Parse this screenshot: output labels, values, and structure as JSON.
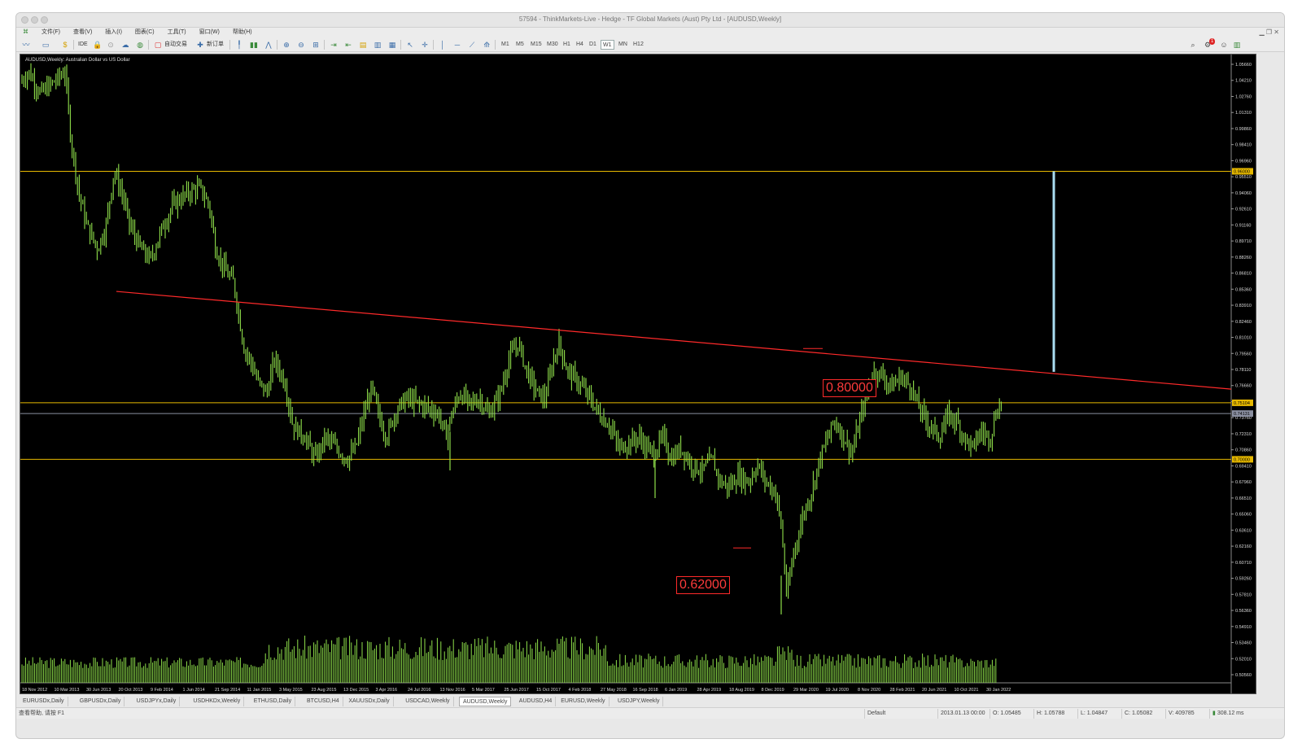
{
  "window": {
    "title": "57594 - ThinkMarkets-Live - Hedge - TF Global Markets (Aust) Pty Ltd - [AUDUSD,Weekly]"
  },
  "menu": {
    "items": [
      "文件(F)",
      "查看(V)",
      "插入(I)",
      "图表(C)",
      "工具(T)",
      "窗口(W)",
      "帮助(H)"
    ]
  },
  "toolbar": {
    "ide_label": "IDE",
    "new_order_label": "新订单",
    "algo_label": "自动交易",
    "timeframes": [
      "M1",
      "M5",
      "M15",
      "M30",
      "H1",
      "H4",
      "D1",
      "W1",
      "MN",
      "H12"
    ],
    "active_timeframe": "W1",
    "notification_count": "1"
  },
  "chart": {
    "symbol_label": "AUDUSD,Weekly:  Australian Dollar vs US Dollar",
    "annotation_high": "0.80000",
    "annotation_low": "0.62000",
    "price_axis": [
      "1.05660",
      "1.04210",
      "1.02760",
      "1.01310",
      "0.99860",
      "0.98410",
      "0.96960",
      "0.95510",
      "0.94060",
      "0.92610",
      "0.91160",
      "0.89710",
      "0.88260",
      "0.86810",
      "0.85360",
      "0.83910",
      "0.82460",
      "0.81010",
      "0.79560",
      "0.78110",
      "0.76660",
      "0.75210",
      "0.73760",
      "0.72310",
      "0.70860",
      "0.69410",
      "0.67960",
      "0.66510",
      "0.65060",
      "0.63610",
      "0.62160",
      "0.60710",
      "0.59260",
      "0.57810",
      "0.56360",
      "0.54910",
      "0.53460",
      "0.52010",
      "0.50560"
    ],
    "price_tags": {
      "top_line": "0.96000",
      "mid_line": "0.75104",
      "current": "0.74131",
      "low_line": "0.70000"
    },
    "date_axis": [
      "18 Nov 2012",
      "10 Mar 2013",
      "30 Jun 2013",
      "20 Oct 2013",
      "9 Feb 2014",
      "1 Jun 2014",
      "21 Sep 2014",
      "11 Jan 2015",
      "3 May 2015",
      "23 Aug 2015",
      "13 Dec 2015",
      "3 Apr 2016",
      "24 Jul 2016",
      "13 Nov 2016",
      "5 Mar 2017",
      "25 Jun 2017",
      "15 Oct 2017",
      "4 Feb 2018",
      "27 May 2018",
      "16 Sep 2018",
      "6 Jan 2019",
      "28 Apr 2019",
      "18 Aug 2019",
      "8 Dec 2019",
      "29 Mar 2020",
      "19 Jul 2020",
      "8 Nov 2020",
      "28 Feb 2021",
      "20 Jun 2021",
      "10 Oct 2021",
      "30 Jan 2022"
    ],
    "colors": {
      "candle": "#8fe04a",
      "support_line": "#e6b800",
      "trend_line": "#ff2a2a",
      "bracket": "#a9dcf0"
    }
  },
  "tabs": {
    "items": [
      "EURUSDx,Daily",
      "GBPUSDx,Daily",
      "USDJPYx,Daily",
      "USDHKDx,Weekly",
      "ETHUSD,Daily",
      "BTCUSD,H4",
      "XAUUSDx,Daily",
      "USDCAD,Weekly",
      "AUDUSD,Weekly",
      "AUDUSD,H4",
      "EURUSD,Weekly",
      "USDJPY,Weekly"
    ],
    "active": "AUDUSD,Weekly"
  },
  "status": {
    "help": "查看帮助, 请按 F1",
    "profile": "Default",
    "datetime": "2013.01.13 00:00",
    "open": "O: 1.05485",
    "high": "H: 1.05788",
    "low": "L: 1.04847",
    "close": "C: 1.05082",
    "volume": "V: 409785",
    "traffic": "308.12 ms"
  }
}
